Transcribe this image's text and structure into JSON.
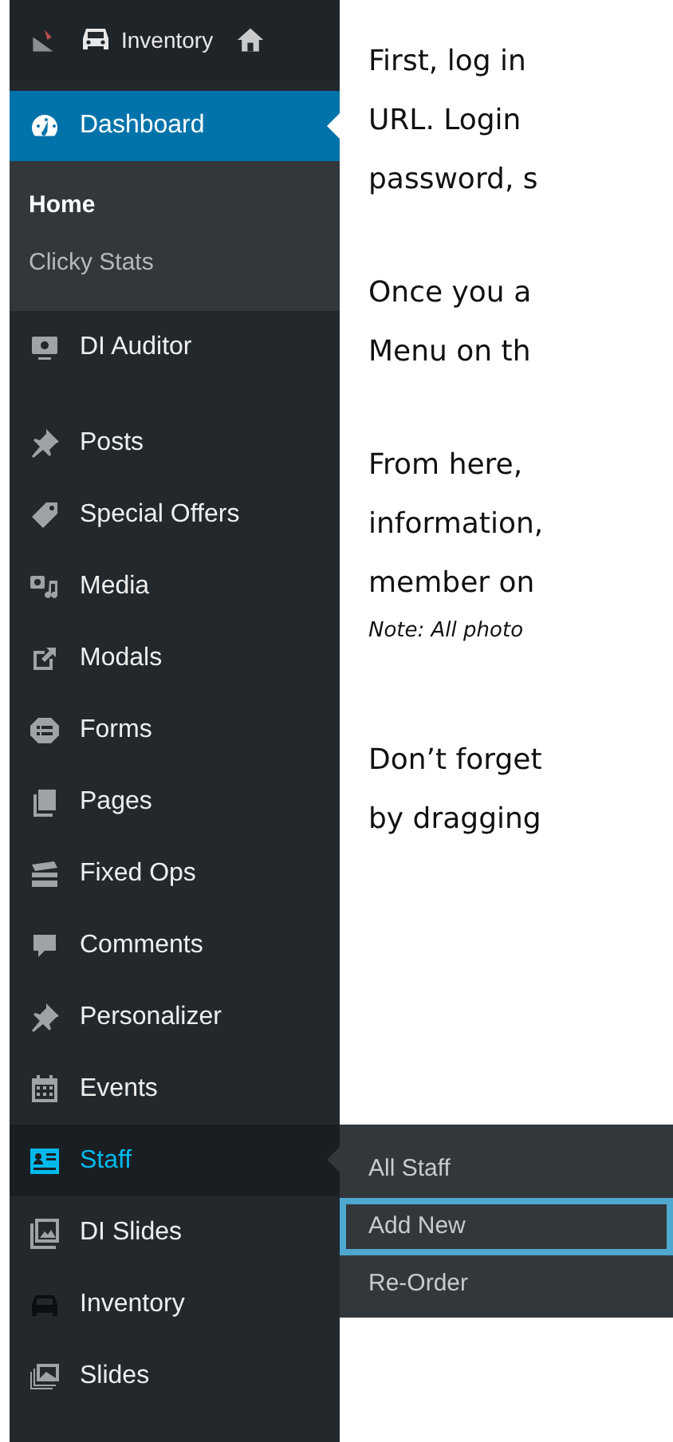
{
  "top_bar": {
    "site_name": "Inventory"
  },
  "sidebar": {
    "items": [
      {
        "label": "Dashboard",
        "current": true,
        "open": false,
        "children": [
          {
            "label": "Home",
            "selected": true
          },
          {
            "label": "Clicky Stats",
            "selected": false
          }
        ]
      },
      {
        "label": "DI Auditor",
        "current": false,
        "open": false
      },
      {
        "label": "Posts",
        "current": false,
        "open": false
      },
      {
        "label": "Special Offers",
        "current": false,
        "open": false
      },
      {
        "label": "Media",
        "current": false,
        "open": false
      },
      {
        "label": "Modals",
        "current": false,
        "open": false
      },
      {
        "label": "Forms",
        "current": false,
        "open": false
      },
      {
        "label": "Pages",
        "current": false,
        "open": false
      },
      {
        "label": "Fixed Ops",
        "current": false,
        "open": false
      },
      {
        "label": "Comments",
        "current": false,
        "open": false
      },
      {
        "label": "Personalizer",
        "current": false,
        "open": false
      },
      {
        "label": "Events",
        "current": false,
        "open": false
      },
      {
        "label": "Staff",
        "current": false,
        "open": true,
        "children": [
          {
            "label": "All Staff",
            "focused": false
          },
          {
            "label": "Add New",
            "focused": true
          },
          {
            "label": "Re-Order",
            "focused": false
          }
        ]
      },
      {
        "label": "DI Slides",
        "current": false,
        "open": false
      },
      {
        "label": "Inventory",
        "current": false,
        "open": false
      },
      {
        "label": "Slides",
        "current": false,
        "open": false
      }
    ]
  },
  "article": {
    "paragraphs": [
      {
        "kind": "text",
        "lines": [
          "First, log in",
          "URL. Login",
          "password, s"
        ]
      },
      {
        "kind": "text",
        "lines": [
          "Once you a",
          "Menu on th"
        ]
      },
      {
        "kind": "text",
        "lines": [
          "From here,",
          "information,",
          "member on"
        ]
      },
      {
        "kind": "note",
        "lines": [
          "Note: All photo"
        ]
      },
      {
        "kind": "text",
        "lines": [
          "Don’t forget",
          "by dragging"
        ]
      }
    ]
  }
}
